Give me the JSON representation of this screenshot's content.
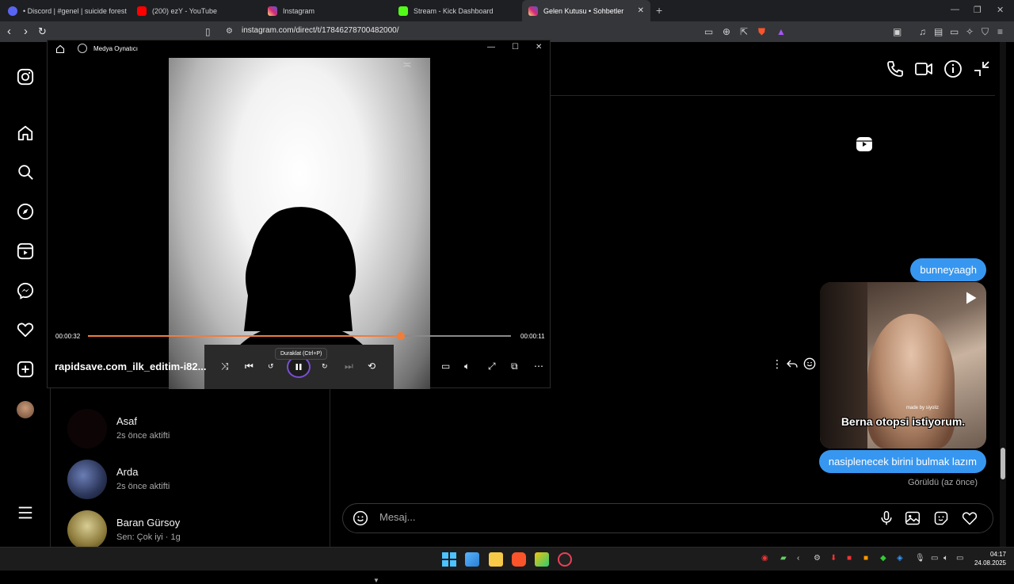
{
  "browser": {
    "tabs": [
      {
        "label": "• Discord | #genel | suicide forest",
        "favicon_color": "#5865f2"
      },
      {
        "label": "(200) ezY - YouTube",
        "favicon_color": "#ff0000"
      },
      {
        "label": "Instagram",
        "favicon_color": "#d6249f"
      },
      {
        "label": "Stream - Kick Dashboard",
        "favicon_color": "#53fc18"
      },
      {
        "label": "Gelen Kutusu • Sohbetler",
        "favicon_color": "#d6249f",
        "active": true
      }
    ],
    "new_tab_icon": "+",
    "url": "instagram.com/direct/t/17846278700482000/"
  },
  "media_player": {
    "title": "Medya Oynatıcı",
    "elapsed": "00:00:32",
    "remaining": "00:00:11",
    "progress": 0.74,
    "filename": "rapidsave.com_ilk_editim-i82...",
    "tooltip": "Duraklat (Ctrl+P)",
    "accent_color": "#ef7d3c"
  },
  "conversations": [
    {
      "name": "Asaf",
      "status": "2s önce aktifti"
    },
    {
      "name": "Arda",
      "status": "2s önce aktifti"
    },
    {
      "name": "Baran Gürsoy",
      "status": "Sen: Çok iyi · 1g"
    }
  ],
  "chat": {
    "messages": [
      {
        "text": "bunneyaagh"
      },
      {
        "text": "nasiplenecek birini bulmak lazım"
      }
    ],
    "reel_caption": "Berna otopsi istiyorum.",
    "reel_watermark": "made by siyoliz",
    "seen": "Görüldü (az önce)",
    "composer_placeholder": "Mesaj...",
    "bubble_color": "#3797f0"
  },
  "taskbar": {
    "time": "04:17",
    "date": "24.08.2025"
  }
}
